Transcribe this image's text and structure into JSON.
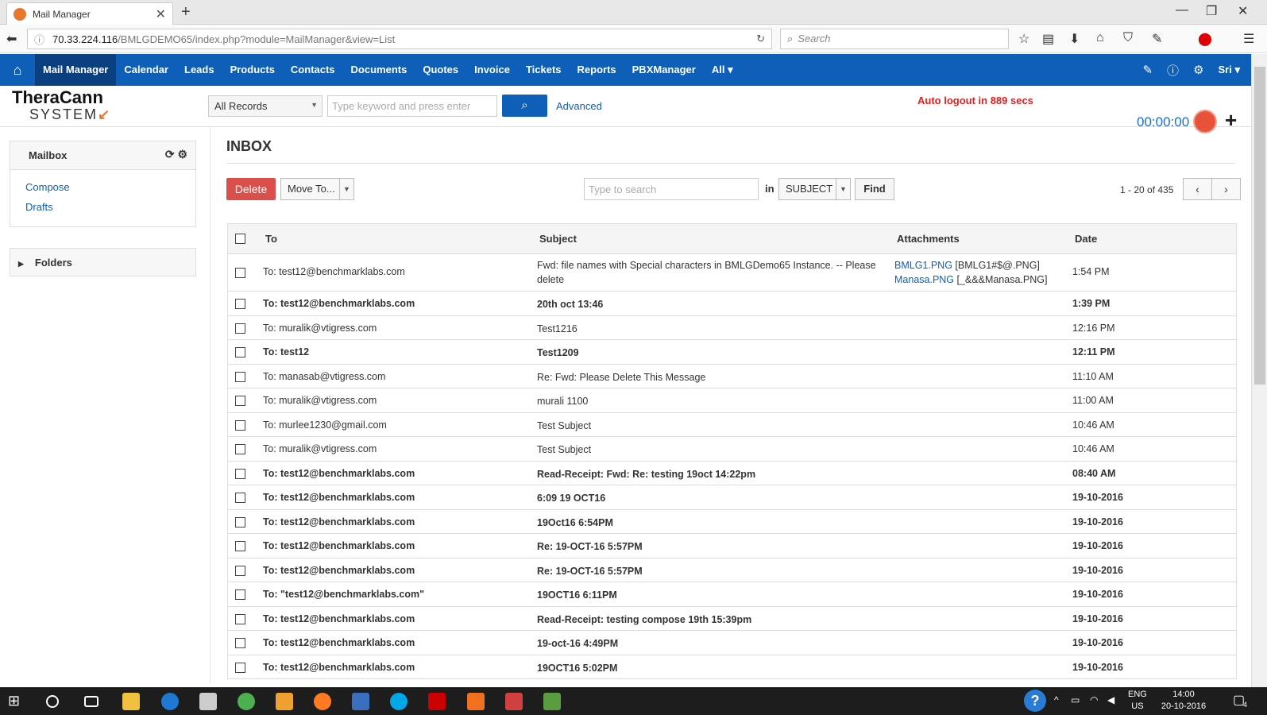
{
  "browser": {
    "tab_title": "Mail Manager",
    "url_host": "70.33.224.116",
    "url_path": "/BMLGDEMO65/index.php?module=MailManager&view=List",
    "search_placeholder": "Search"
  },
  "appnav": {
    "items": [
      "Mail Manager",
      "Calendar",
      "Leads",
      "Products",
      "Contacts",
      "Documents",
      "Quotes",
      "Invoice",
      "Tickets",
      "Reports",
      "PBXManager",
      "All ▾"
    ],
    "user": "Sri ▾"
  },
  "header": {
    "logo_line1": "TheraCann",
    "logo_line2": "SYSTEM",
    "record_type": "All Records",
    "keyword_placeholder": "Type keyword and press enter",
    "advanced": "Advanced",
    "auto_logout": "Auto logout in 889 secs",
    "timer": "00:00:00"
  },
  "sidebar": {
    "mailbox_title": "Mailbox",
    "compose": "Compose",
    "drafts": "Drafts",
    "folders": "Folders"
  },
  "main": {
    "title": "INBOX",
    "delete": "Delete",
    "move_to": "Move To...",
    "search_placeholder": "Type to search",
    "in_label": "in",
    "search_field": "SUBJECT",
    "find": "Find",
    "page_info": "1 - 20 of 435"
  },
  "table": {
    "headers": {
      "to": "To",
      "subject": "Subject",
      "attachments": "Attachments",
      "date": "Date"
    },
    "rows": [
      {
        "to": "To: test12@benchmarklabs.com",
        "subject": "Fwd: file names with Special characters in BMLGDemo65 Instance. -- Please delete",
        "att1_link": "BMLG1.PNG",
        "att1_name": " [BMLG1#$@.PNG]",
        "att2_link": "Manasa.PNG",
        "att2_name": " [_&&&Manasa.PNG]",
        "date": "1:54 PM",
        "bold": false
      },
      {
        "to": "To: test12@benchmarklabs.com",
        "subject": "20th oct 13:46",
        "date": "1:39 PM",
        "bold": true
      },
      {
        "to": "To: muralik@vtigress.com",
        "subject": "Test1216",
        "date": "12:16 PM",
        "bold": false
      },
      {
        "to": "To: test12",
        "subject": "Test1209",
        "date": "12:11 PM",
        "bold": true
      },
      {
        "to": "To: manasab@vtigress.com",
        "subject": "Re: Fwd: Please Delete This Message",
        "date": "11:10 AM",
        "bold": false
      },
      {
        "to": "To: muralik@vtigress.com",
        "subject": "murali 1100",
        "date": "11:00 AM",
        "bold": false
      },
      {
        "to": "To: murlee1230@gmail.com",
        "subject": "Test Subject",
        "date": "10:46 AM",
        "bold": false
      },
      {
        "to": "To: muralik@vtigress.com",
        "subject": "Test Subject",
        "date": "10:46 AM",
        "bold": false
      },
      {
        "to": "To: test12@benchmarklabs.com",
        "subject": "Read-Receipt: Fwd: Re: testing 19oct 14:22pm",
        "date": "08:40 AM",
        "bold": true
      },
      {
        "to": "To: test12@benchmarklabs.com",
        "subject": "6:09 19 OCT16",
        "date": "19-10-2016",
        "bold": true
      },
      {
        "to": "To: test12@benchmarklabs.com",
        "subject": "19Oct16 6:54PM",
        "date": "19-10-2016",
        "bold": true
      },
      {
        "to": "To: test12@benchmarklabs.com",
        "subject": "Re: 19-OCT-16 5:57PM",
        "date": "19-10-2016",
        "bold": true
      },
      {
        "to": "To: test12@benchmarklabs.com",
        "subject": "Re: 19-OCT-16 5:57PM",
        "date": "19-10-2016",
        "bold": true
      },
      {
        "to": "To: \"test12@benchmarklabs.com\"",
        "subject": "19OCT16 6:11PM",
        "date": "19-10-2016",
        "bold": true
      },
      {
        "to": "To: test12@benchmarklabs.com",
        "subject": "Read-Receipt: testing compose 19th 15:39pm",
        "date": "19-10-2016",
        "bold": true
      },
      {
        "to": "To: test12@benchmarklabs.com",
        "subject": "19-oct-16 4:49PM",
        "date": "19-10-2016",
        "bold": true
      },
      {
        "to": "To: test12@benchmarklabs.com",
        "subject": "19OCT16 5:02PM",
        "date": "19-10-2016",
        "bold": true
      }
    ]
  },
  "taskbar": {
    "lang1": "ENG",
    "lang2": "US",
    "time": "14:00",
    "date": "20-10-2016",
    "notif": "4"
  }
}
